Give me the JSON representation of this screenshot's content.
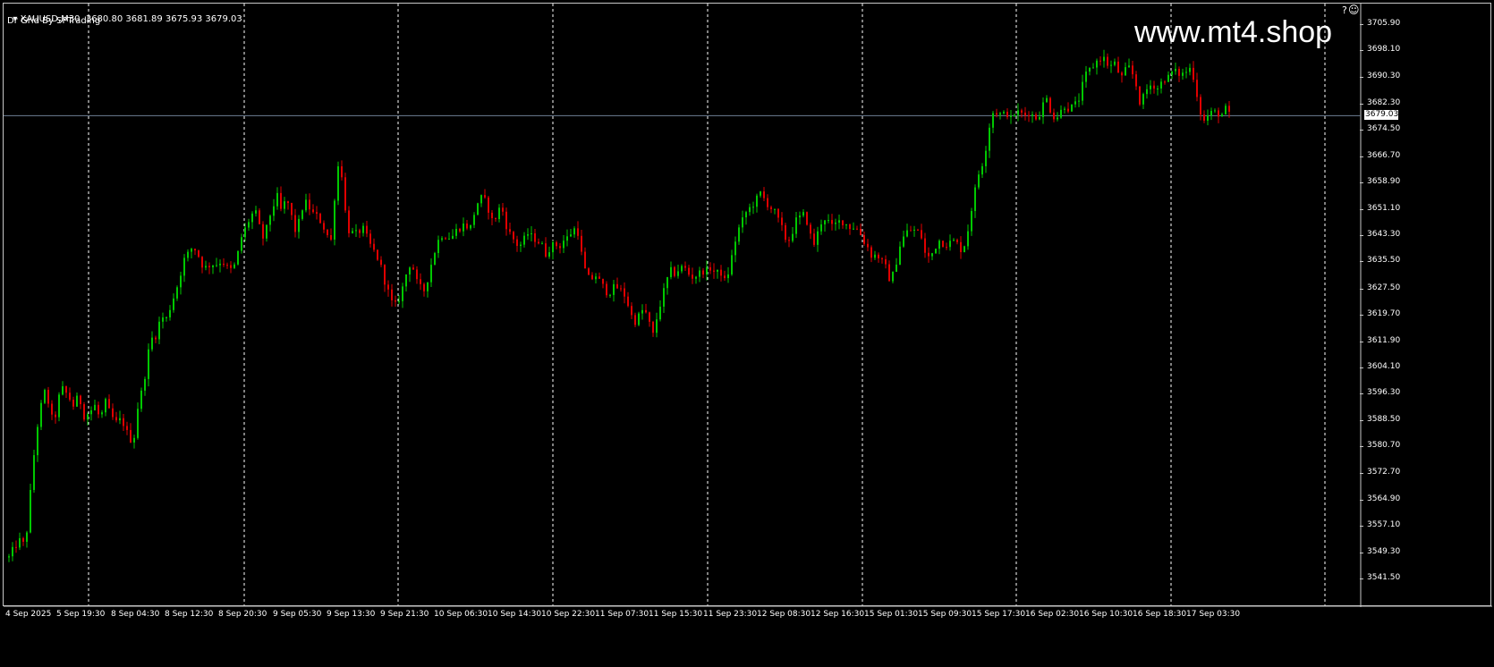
{
  "header": {
    "symbol_line": "XAUUSD,M30  3680.80 3681.89 3675.93 3679.03",
    "indicator": "Dr Grid By SPTrading"
  },
  "watermark": "www.mt4.shop",
  "icons": {
    "menu": "triangle-down-icon",
    "help": "question-icon",
    "smile": "smiley-icon"
  },
  "colors": {
    "background": "#000000",
    "bull_candle": "#00c800",
    "bear_candle": "#e00000",
    "grid": "#ffffff",
    "bid_line": "#6e7f95",
    "frame": "#c8c8c8"
  },
  "bid_badge": "3679.03",
  "chart_data": {
    "type": "candlestick",
    "symbol": "XAUUSD",
    "timeframe": "M30",
    "ohlc_last": {
      "open": 3680.8,
      "high": 3681.89,
      "low": 3675.93,
      "close": 3679.03
    },
    "current_price": 3679.03,
    "y_ticks": [
      "3705.90",
      "3698.10",
      "3690.30",
      "3682.30",
      "3674.50",
      "3666.70",
      "3658.90",
      "3651.10",
      "3643.30",
      "3635.50",
      "3627.50",
      "3619.70",
      "3611.90",
      "3604.10",
      "3596.30",
      "3588.50",
      "3580.70",
      "3572.70",
      "3564.90",
      "3557.10",
      "3549.30",
      "3541.50"
    ],
    "x_ticks": [
      "4 Sep 2025",
      "5 Sep 19:30",
      "8 Sep 04:30",
      "8 Sep 12:30",
      "8 Sep 20:30",
      "9 Sep 05:30",
      "9 Sep 13:30",
      "9 Sep 21:30",
      "10 Sep 06:30",
      "10 Sep 14:30",
      "10 Sep 22:30",
      "11 Sep 07:30",
      "11 Sep 15:30",
      "11 Sep 23:30",
      "12 Sep 08:30",
      "12 Sep 16:30",
      "15 Sep 01:30",
      "15 Sep 09:30",
      "15 Sep 17:30",
      "16 Sep 02:30",
      "16 Sep 10:30",
      "16 Sep 18:30",
      "17 Sep 03:30"
    ],
    "ylim": [
      3541.5,
      3705.9
    ],
    "price_path": [
      [
        0,
        3548
      ],
      [
        6,
        3551
      ],
      [
        12,
        3553
      ],
      [
        16,
        3552
      ],
      [
        20,
        3556
      ],
      [
        25,
        3570
      ],
      [
        30,
        3584
      ],
      [
        35,
        3592
      ],
      [
        40,
        3597
      ],
      [
        44,
        3594
      ],
      [
        50,
        3587
      ],
      [
        55,
        3595
      ],
      [
        60,
        3598
      ],
      [
        66,
        3596
      ],
      [
        72,
        3593
      ],
      [
        78,
        3596
      ],
      [
        84,
        3590
      ],
      [
        90,
        3591
      ],
      [
        96,
        3593
      ],
      [
        102,
        3589
      ],
      [
        108,
        3594
      ],
      [
        114,
        3590
      ],
      [
        120,
        3588
      ],
      [
        126,
        3589
      ],
      [
        132,
        3585
      ],
      [
        138,
        3582
      ],
      [
        141,
        3585
      ],
      [
        145,
        3595
      ],
      [
        150,
        3598
      ],
      [
        155,
        3608
      ],
      [
        160,
        3613
      ],
      [
        165,
        3614
      ],
      [
        170,
        3620
      ],
      [
        175,
        3618
      ],
      [
        180,
        3622
      ],
      [
        185,
        3626
      ],
      [
        190,
        3630
      ],
      [
        195,
        3636
      ],
      [
        200,
        3638
      ],
      [
        205,
        3640
      ],
      [
        210,
        3639
      ],
      [
        215,
        3635
      ],
      [
        220,
        3634
      ],
      [
        226,
        3635
      ],
      [
        232,
        3635
      ],
      [
        238,
        3636
      ],
      [
        244,
        3634
      ],
      [
        250,
        3633
      ],
      [
        254,
        3636
      ],
      [
        260,
        3643
      ],
      [
        265,
        3646
      ],
      [
        270,
        3649
      ],
      [
        275,
        3651
      ],
      [
        280,
        3646
      ],
      [
        285,
        3642
      ],
      [
        290,
        3648
      ],
      [
        295,
        3652
      ],
      [
        300,
        3655
      ],
      [
        305,
        3650
      ],
      [
        310,
        3655
      ],
      [
        315,
        3650
      ],
      [
        320,
        3645
      ],
      [
        325,
        3648
      ],
      [
        330,
        3654
      ],
      [
        335,
        3652
      ],
      [
        340,
        3650
      ],
      [
        345,
        3649
      ],
      [
        350,
        3647
      ],
      [
        355,
        3644
      ],
      [
        360,
        3642
      ],
      [
        365,
        3658
      ],
      [
        370,
        3668
      ],
      [
        375,
        3652
      ],
      [
        380,
        3645
      ],
      [
        385,
        3644
      ],
      [
        390,
        3644
      ],
      [
        395,
        3646
      ],
      [
        400,
        3643
      ],
      [
        405,
        3640
      ],
      [
        410,
        3638
      ],
      [
        415,
        3635
      ],
      [
        420,
        3630
      ],
      [
        425,
        3626
      ],
      [
        430,
        3622
      ],
      [
        435,
        3624
      ],
      [
        440,
        3628
      ],
      [
        445,
        3633
      ],
      [
        450,
        3636
      ],
      [
        455,
        3630
      ],
      [
        460,
        3628
      ],
      [
        465,
        3627
      ],
      [
        470,
        3633
      ],
      [
        475,
        3638
      ],
      [
        480,
        3642
      ],
      [
        485,
        3644
      ],
      [
        490,
        3643
      ],
      [
        495,
        3643
      ],
      [
        500,
        3645
      ],
      [
        505,
        3646
      ],
      [
        510,
        3647
      ],
      [
        515,
        3645
      ],
      [
        520,
        3650
      ],
      [
        525,
        3654
      ],
      [
        530,
        3655
      ],
      [
        535,
        3652
      ],
      [
        540,
        3648
      ],
      [
        545,
        3649
      ],
      [
        550,
        3653
      ],
      [
        555,
        3647
      ],
      [
        560,
        3644
      ],
      [
        565,
        3642
      ],
      [
        570,
        3640
      ],
      [
        575,
        3642
      ],
      [
        580,
        3644
      ],
      [
        585,
        3643
      ],
      [
        590,
        3642
      ],
      [
        595,
        3641
      ],
      [
        600,
        3638
      ],
      [
        605,
        3640
      ],
      [
        610,
        3641
      ],
      [
        615,
        3640
      ],
      [
        620,
        3642
      ],
      [
        625,
        3643
      ],
      [
        630,
        3645
      ],
      [
        635,
        3646
      ],
      [
        640,
        3638
      ],
      [
        645,
        3632
      ],
      [
        650,
        3630
      ],
      [
        655,
        3632
      ],
      [
        660,
        3630
      ],
      [
        665,
        3628
      ],
      [
        670,
        3626
      ],
      [
        675,
        3628
      ],
      [
        680,
        3628
      ],
      [
        685,
        3627
      ],
      [
        690,
        3625
      ],
      [
        695,
        3620
      ],
      [
        700,
        3618
      ],
      [
        705,
        3620
      ],
      [
        710,
        3622
      ],
      [
        715,
        3618
      ],
      [
        720,
        3614
      ],
      [
        725,
        3620
      ],
      [
        730,
        3625
      ],
      [
        735,
        3630
      ],
      [
        740,
        3633
      ],
      [
        745,
        3632
      ],
      [
        750,
        3634
      ],
      [
        755,
        3634
      ],
      [
        760,
        3632
      ],
      [
        765,
        3631
      ],
      [
        770,
        3632
      ],
      [
        775,
        3633
      ],
      [
        780,
        3633
      ],
      [
        785,
        3634
      ],
      [
        790,
        3632
      ],
      [
        795,
        3633
      ],
      [
        800,
        3630
      ],
      [
        805,
        3633
      ],
      [
        810,
        3640
      ],
      [
        815,
        3645
      ],
      [
        820,
        3648
      ],
      [
        825,
        3651
      ],
      [
        830,
        3652
      ],
      [
        835,
        3654
      ],
      [
        840,
        3656
      ],
      [
        845,
        3654
      ],
      [
        850,
        3652
      ],
      [
        855,
        3651
      ],
      [
        860,
        3648
      ],
      [
        865,
        3645
      ],
      [
        870,
        3641
      ],
      [
        875,
        3644
      ],
      [
        880,
        3648
      ],
      [
        885,
        3649
      ],
      [
        890,
        3650
      ],
      [
        895,
        3644
      ],
      [
        900,
        3641
      ],
      [
        905,
        3645
      ],
      [
        910,
        3649
      ],
      [
        915,
        3648
      ],
      [
        920,
        3646
      ],
      [
        925,
        3647
      ],
      [
        930,
        3648
      ],
      [
        935,
        3647
      ],
      [
        940,
        3646
      ],
      [
        945,
        3646
      ],
      [
        950,
        3645
      ],
      [
        955,
        3642
      ],
      [
        960,
        3640
      ],
      [
        965,
        3637
      ],
      [
        970,
        3638
      ],
      [
        975,
        3636
      ],
      [
        980,
        3634
      ],
      [
        985,
        3630
      ],
      [
        990,
        3633
      ],
      [
        995,
        3640
      ],
      [
        1000,
        3643
      ],
      [
        1005,
        3645
      ],
      [
        1010,
        3645
      ],
      [
        1015,
        3645
      ],
      [
        1020,
        3643
      ],
      [
        1025,
        3637
      ],
      [
        1030,
        3637
      ],
      [
        1035,
        3640
      ],
      [
        1040,
        3642
      ],
      [
        1045,
        3641
      ],
      [
        1050,
        3641
      ],
      [
        1055,
        3642
      ],
      [
        1060,
        3641
      ],
      [
        1065,
        3639
      ],
      [
        1070,
        3642
      ],
      [
        1075,
        3650
      ],
      [
        1080,
        3657
      ],
      [
        1085,
        3663
      ],
      [
        1090,
        3666
      ],
      [
        1095,
        3675
      ],
      [
        1100,
        3680
      ],
      [
        1105,
        3680
      ],
      [
        1110,
        3679
      ],
      [
        1115,
        3680
      ],
      [
        1120,
        3678
      ],
      [
        1125,
        3680
      ],
      [
        1130,
        3680
      ],
      [
        1135,
        3679
      ],
      [
        1140,
        3680
      ],
      [
        1145,
        3679
      ],
      [
        1150,
        3678
      ],
      [
        1155,
        3682
      ],
      [
        1160,
        3684
      ],
      [
        1165,
        3680
      ],
      [
        1170,
        3678
      ],
      [
        1175,
        3680
      ],
      [
        1180,
        3682
      ],
      [
        1185,
        3681
      ],
      [
        1190,
        3682
      ],
      [
        1195,
        3683
      ],
      [
        1200,
        3688
      ],
      [
        1205,
        3692
      ],
      [
        1210,
        3693
      ],
      [
        1215,
        3695
      ],
      [
        1220,
        3696
      ],
      [
        1225,
        3696
      ],
      [
        1230,
        3693
      ],
      [
        1235,
        3695
      ],
      [
        1240,
        3692
      ],
      [
        1245,
        3690
      ],
      [
        1250,
        3694
      ],
      [
        1255,
        3692
      ],
      [
        1260,
        3688
      ],
      [
        1265,
        3682
      ],
      [
        1270,
        3686
      ],
      [
        1275,
        3688
      ],
      [
        1280,
        3688
      ],
      [
        1285,
        3687
      ],
      [
        1290,
        3690
      ],
      [
        1295,
        3690
      ],
      [
        1300,
        3692
      ],
      [
        1305,
        3692
      ],
      [
        1310,
        3691
      ],
      [
        1315,
        3692
      ],
      [
        1320,
        3693
      ],
      [
        1325,
        3690
      ],
      [
        1330,
        3682
      ],
      [
        1335,
        3677
      ],
      [
        1340,
        3679
      ],
      [
        1345,
        3680
      ],
      [
        1350,
        3680
      ],
      [
        1355,
        3679
      ],
      [
        1360,
        3681
      ],
      [
        1365,
        3679.03
      ]
    ]
  }
}
